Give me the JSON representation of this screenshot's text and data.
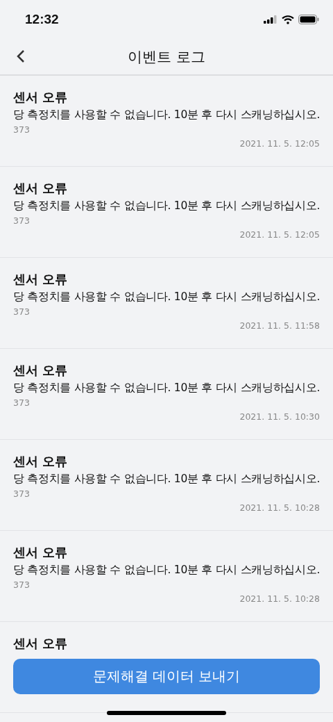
{
  "status_bar": {
    "time": "12:32"
  },
  "header": {
    "title": "이벤트 로그"
  },
  "events": [
    {
      "title": "센서 오류",
      "message": "당 측정치를 사용할 수 없습니다. 10분 후 다시 스캐닝하십시오.",
      "code": "373",
      "timestamp": "2021. 11. 5. 12:05"
    },
    {
      "title": "센서 오류",
      "message": "당 측정치를 사용할 수 없습니다. 10분 후 다시 스캐닝하십시오.",
      "code": "373",
      "timestamp": "2021. 11. 5. 12:05"
    },
    {
      "title": "센서 오류",
      "message": "당 측정치를 사용할 수 없습니다. 10분 후 다시 스캐닝하십시오.",
      "code": "373",
      "timestamp": "2021. 11. 5. 11:58"
    },
    {
      "title": "센서 오류",
      "message": "당 측정치를 사용할 수 없습니다. 10분 후 다시 스캐닝하십시오.",
      "code": "373",
      "timestamp": "2021. 11. 5. 10:30"
    },
    {
      "title": "센서 오류",
      "message": "당 측정치를 사용할 수 없습니다. 10분 후 다시 스캐닝하십시오.",
      "code": "373",
      "timestamp": "2021. 11. 5. 10:28"
    },
    {
      "title": "센서 오류",
      "message": "당 측정치를 사용할 수 없습니다. 10분 후 다시 스캐닝하십시오.",
      "code": "373",
      "timestamp": "2021. 11. 5. 10:28"
    },
    {
      "title": "센서 오류"
    }
  ],
  "send_button": {
    "label": "문제해결 데이터 보내기"
  }
}
